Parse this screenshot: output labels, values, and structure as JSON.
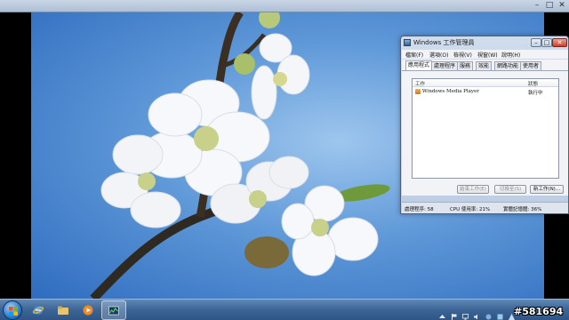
{
  "window_caption": {
    "min_glyph": "–",
    "max_glyph": "□",
    "close_glyph": "✕"
  },
  "task_manager": {
    "title": "Windows 工作管理員",
    "menu": [
      "檔案(F)",
      "選項(O)",
      "檢視(V)",
      "視窗(W)",
      "說明(H)"
    ],
    "tabs": [
      "應用程式",
      "處理程序",
      "服務",
      "效能",
      "網路功能",
      "使用者"
    ],
    "active_tab": "應用程式",
    "list": {
      "col_task": "工作",
      "col_status": "狀態",
      "rows": [
        {
          "name": "Windows Media Player",
          "status": "執行中"
        }
      ]
    },
    "buttons": {
      "end_task": "結束工作(E)",
      "switch_to": "切換至(S)",
      "new_task": "新工作(N)..."
    },
    "status": {
      "processes": "處理程序: 58",
      "cpu": "CPU 使用率: 21%",
      "memory": "實體記憶體: 36%"
    },
    "caption": {
      "min": "–",
      "max": "□",
      "close": "✕"
    }
  },
  "taskbar": {
    "buttons": [
      "start-icon",
      "internet-explorer-icon",
      "windows-explorer-icon",
      "media-player-icon",
      "task-manager-icon"
    ]
  },
  "watermark": "#581694",
  "colors": {
    "sky_blue": "#5e98d8",
    "taskbar_blue": "#3c6596",
    "window_frame": "#bccde3"
  }
}
